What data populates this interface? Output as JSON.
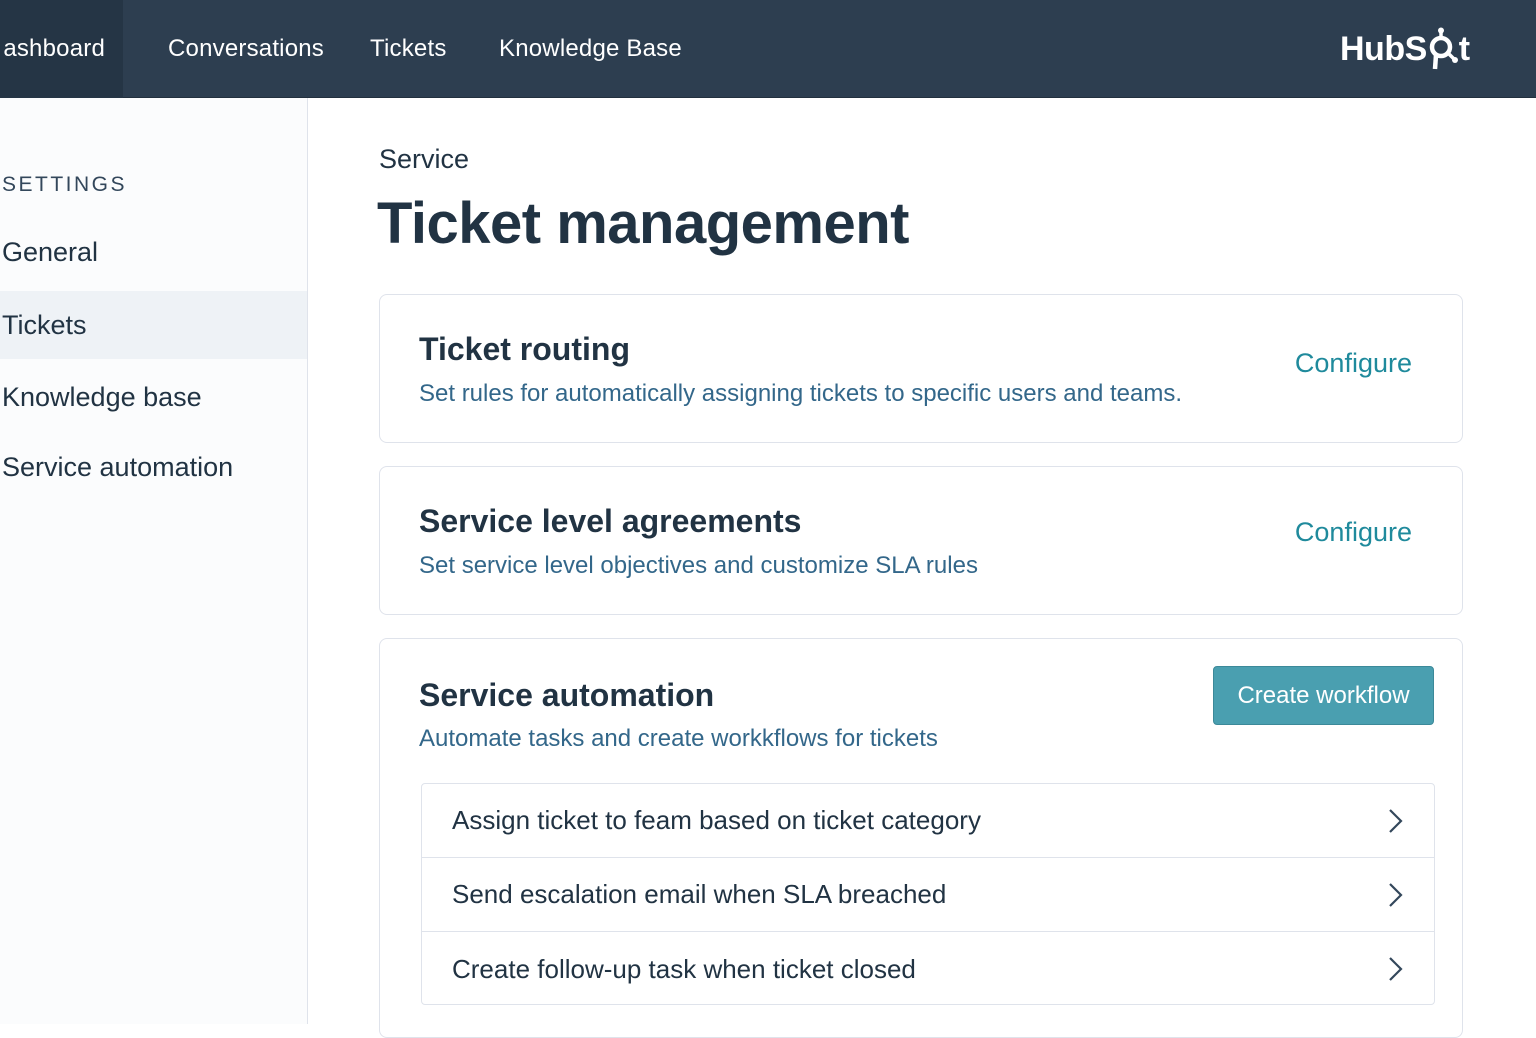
{
  "topnav": {
    "items": [
      {
        "label": "ashboard"
      },
      {
        "label": "Conversations"
      },
      {
        "label": "Tickets"
      },
      {
        "label": "Knowledge Base"
      }
    ],
    "logo": {
      "text_left": "HubS",
      "text_right": "t",
      "icon": "sprocket-icon"
    }
  },
  "sidebar": {
    "heading": "SETTINGS",
    "items": [
      {
        "label": "General"
      },
      {
        "label": "Tickets"
      },
      {
        "label": "Knowledge base"
      },
      {
        "label": "Service automation"
      }
    ]
  },
  "main": {
    "breadcrumb": "Service",
    "title": "Ticket management",
    "cards": {
      "routing": {
        "title": "Ticket routing",
        "description": "Set rules for automatically assigning tickets to specific users and teams.",
        "action": "Configure"
      },
      "sla": {
        "title": "Service level agreements",
        "description": "Set service level objectives and customize SLA rules",
        "action": "Configure"
      },
      "automation": {
        "title": "Service automation",
        "description": "Automate tasks and create workkflows for tickets",
        "button": "Create workflow",
        "workflows": [
          {
            "label": "Assign ticket to feam based on ticket category"
          },
          {
            "label": "Send escalation email when SLA breached"
          },
          {
            "label": "Create follow-up task when ticket closed"
          }
        ]
      }
    }
  },
  "colors": {
    "nav_bg": "#2d3e50",
    "accent": "#1f8a9c",
    "button_bg": "#4a9fb0",
    "text": "#213343"
  }
}
